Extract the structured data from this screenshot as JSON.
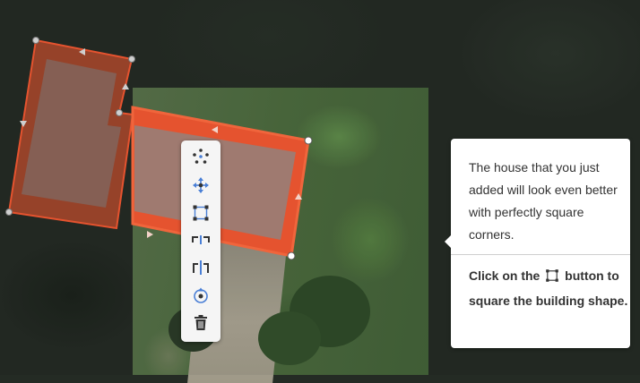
{
  "toolbar": {
    "tools": [
      {
        "name": "circularize-tool",
        "icon": "circularize-icon"
      },
      {
        "name": "move-tool",
        "icon": "move-icon"
      },
      {
        "name": "orthogonalize-tool",
        "icon": "square-corners-icon"
      },
      {
        "name": "straighten-tool",
        "icon": "straighten-icon"
      },
      {
        "name": "reflect-tool",
        "icon": "reflect-icon"
      },
      {
        "name": "rotate-tool",
        "icon": "rotate-icon"
      },
      {
        "name": "delete-tool",
        "icon": "trash-icon"
      }
    ]
  },
  "tooltip": {
    "body_text": "The house that you just added will look even better with perfectly square corners.",
    "footer_prefix": "Click on the",
    "footer_icon": "square-corners-icon",
    "footer_suffix": "button to square the building shape."
  },
  "colors": {
    "building_fill": "#e5532f",
    "building_stroke": "#f0653c",
    "accent_blue": "#4a7fd6",
    "toolbar_bg": "#f5f5f5"
  }
}
